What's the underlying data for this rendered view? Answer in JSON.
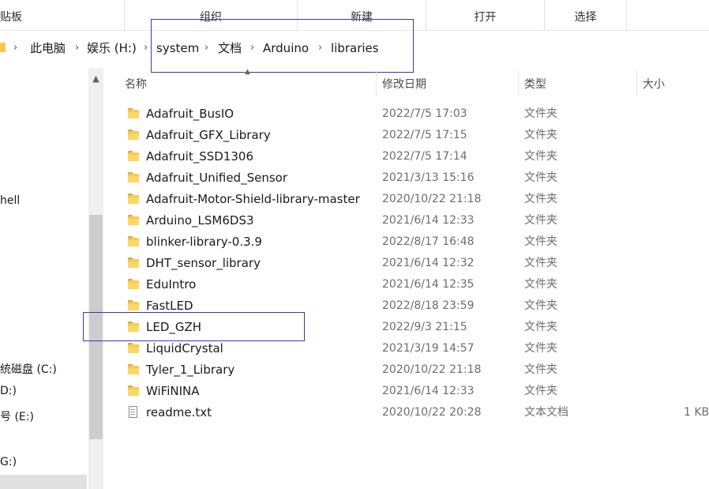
{
  "ribbon": {
    "groups": [
      "贴板",
      "组织",
      "新建",
      "打开",
      "选择"
    ]
  },
  "address": {
    "crumbs": [
      "此电脑",
      "娱乐 (H:)",
      "system",
      "文档",
      "Arduino",
      "libraries"
    ],
    "separator": "›"
  },
  "nav": {
    "items": [
      "hell",
      "统磁盘 (C:)",
      "D:)",
      "号 (E:)",
      "G:)"
    ]
  },
  "columns": {
    "name": "名称",
    "modified": "修改日期",
    "type": "类型",
    "size": "大小"
  },
  "files": [
    {
      "name": "Adafruit_BusIO",
      "modified": "2022/7/5 17:03",
      "type": "文件夹",
      "size": "",
      "icon": "folder-icon"
    },
    {
      "name": "Adafruit_GFX_Library",
      "modified": "2022/7/5 17:15",
      "type": "文件夹",
      "size": "",
      "icon": "folder-icon"
    },
    {
      "name": "Adafruit_SSD1306",
      "modified": "2022/7/5 17:14",
      "type": "文件夹",
      "size": "",
      "icon": "folder-icon"
    },
    {
      "name": "Adafruit_Unified_Sensor",
      "modified": "2021/3/13 15:16",
      "type": "文件夹",
      "size": "",
      "icon": "folder-icon"
    },
    {
      "name": "Adafruit-Motor-Shield-library-master",
      "modified": "2020/10/22 21:18",
      "type": "文件夹",
      "size": "",
      "icon": "folder-icon"
    },
    {
      "name": "Arduino_LSM6DS3",
      "modified": "2021/6/14 12:33",
      "type": "文件夹",
      "size": "",
      "icon": "folder-icon"
    },
    {
      "name": "blinker-library-0.3.9",
      "modified": "2022/8/17 16:48",
      "type": "文件夹",
      "size": "",
      "icon": "folder-icon"
    },
    {
      "name": "DHT_sensor_library",
      "modified": "2021/6/14 12:32",
      "type": "文件夹",
      "size": "",
      "icon": "folder-icon"
    },
    {
      "name": "EduIntro",
      "modified": "2021/6/14 12:35",
      "type": "文件夹",
      "size": "",
      "icon": "folder-icon"
    },
    {
      "name": "FastLED",
      "modified": "2022/8/18 23:59",
      "type": "文件夹",
      "size": "",
      "icon": "folder-icon"
    },
    {
      "name": "LED_GZH",
      "modified": "2022/9/3 21:15",
      "type": "文件夹",
      "size": "",
      "icon": "folder-icon"
    },
    {
      "name": "LiquidCrystal",
      "modified": "2021/3/19 14:57",
      "type": "文件夹",
      "size": "",
      "icon": "folder-icon"
    },
    {
      "name": "Tyler_1_Library",
      "modified": "2020/10/22 21:18",
      "type": "文件夹",
      "size": "",
      "icon": "folder-icon"
    },
    {
      "name": "WiFiNINA",
      "modified": "2021/6/14 12:33",
      "type": "文件夹",
      "size": "",
      "icon": "folder-icon"
    },
    {
      "name": "readme.txt",
      "modified": "2020/10/22 20:28",
      "type": "文本文档",
      "size": "1 KB",
      "icon": "text-file-icon"
    }
  ],
  "colors": {
    "annotation_box": "#3a3aa5",
    "folder": "#f8c94b",
    "secondary_text": "#6d6d6d"
  }
}
